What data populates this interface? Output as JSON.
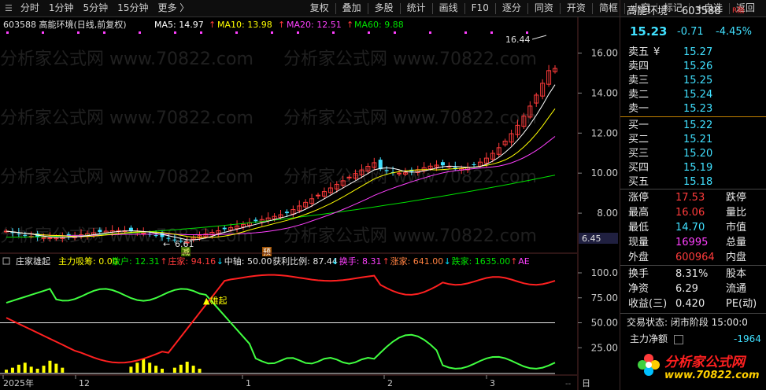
{
  "toolbar": {
    "left_items": [
      "分时",
      "1分钟",
      "5分钟",
      "15分钟",
      "更多 〉"
    ],
    "right_items": [
      "复权",
      "叠加",
      "多股",
      "统计",
      "画线",
      "F10",
      "逐分",
      "同资",
      "开资",
      "简框",
      "小窗",
      "标记",
      "+自选",
      "返回"
    ]
  },
  "info_line": {
    "stock": "603588 高能环境(日线,前复权)",
    "ma5": "MA5: 14.97",
    "ma10": "MA10: 13.98",
    "ma20": "MA20: 12.51",
    "ma60": "MA60: 9.88",
    "arrow": "↑"
  },
  "chart_labels": {
    "high_marker": "16.44",
    "low_marker": "6.61",
    "cross_price": "6.45",
    "signal_a": "减",
    "signal_b": "预",
    "signal_rise": "▲雄起"
  },
  "indicator_line": {
    "name": "庄家雄起",
    "items": [
      {
        "text": "主力吸筹: 0.00",
        "color": "#ffff00"
      },
      {
        "text": "散户: 12.31",
        "color": "#00e000",
        "arrow": "↑",
        "arrow_color": "#ff3b3b"
      },
      {
        "text": "庄家: 94.16",
        "color": "#ff3b3b",
        "arrow": "↓",
        "arrow_color": "#00e0ff"
      },
      {
        "text": "中轴: 50.00",
        "color": "#e8e8e8"
      },
      {
        "text": "获利比例: 87.44",
        "color": "#e8e8e8",
        "arrow": "↓",
        "arrow_color": "#00e0ff"
      },
      {
        "text": "换手: 8.31",
        "color": "#ff40ff",
        "arrow": "↑",
        "arrow_color": "#ff3b3b"
      },
      {
        "text": "涨家: 641.00",
        "color": "#ff8040",
        "arrow": "↓",
        "arrow_color": "#00e0ff"
      },
      {
        "text": "跌家: 1635.00",
        "color": "#00e000",
        "arrow": "↑",
        "arrow_color": "#ff3b3b"
      },
      {
        "text": "AE",
        "color": "#ff40ff"
      }
    ]
  },
  "price_axis": [
    "16.00",
    "14.00",
    "12.00",
    "10.00",
    "8.00"
  ],
  "indicator_axis": [
    "100.0",
    "75.00",
    "50.00",
    "25.00"
  ],
  "date_axis": [
    "2025年",
    "12",
    "1",
    "2",
    "3"
  ],
  "watermark": "分析家公式网 www.70822.com",
  "quote": {
    "name": "高能环境",
    "code": "603588",
    "badge": "R融",
    "price": "15.23",
    "change": "-0.71",
    "change_pct": "-4.45%",
    "asks": [
      {
        "label": "卖五",
        "unit": "¥",
        "price": "15.27"
      },
      {
        "label": "卖四",
        "price": "15.26"
      },
      {
        "label": "卖三",
        "price": "15.25"
      },
      {
        "label": "卖二",
        "price": "15.24"
      },
      {
        "label": "卖一",
        "price": "15.23"
      }
    ],
    "bids": [
      {
        "label": "买一",
        "price": "15.22"
      },
      {
        "label": "买二",
        "price": "15.21"
      },
      {
        "label": "买三",
        "price": "15.20"
      },
      {
        "label": "买四",
        "price": "15.19"
      },
      {
        "label": "买五",
        "price": "15.18"
      }
    ],
    "stats": [
      {
        "label": "涨停",
        "value": "17.53",
        "vclass": "red",
        "label2": "跌停"
      },
      {
        "label": "最高",
        "value": "16.06",
        "vclass": "red",
        "label2": "量比"
      },
      {
        "label": "最低",
        "value": "14.70",
        "vclass": "cyan",
        "label2": "市值"
      },
      {
        "label": "现量",
        "value": "16995",
        "vclass": "magenta",
        "label2": "总量"
      },
      {
        "label": "外盘",
        "value": "600964",
        "vclass": "red",
        "label2": "内盘"
      }
    ],
    "stats2": [
      {
        "label": "换手",
        "value": "8.31%",
        "label2": "股本"
      },
      {
        "label": "净资",
        "value": "6.29",
        "label2": "流通"
      },
      {
        "label": "收益(三)",
        "value": "0.420",
        "label2": "PE(动)"
      }
    ],
    "status": "交易状态: 闭市阶段 15:00:0",
    "net_label": "主力净额",
    "net_value": "-1964",
    "logo_text": "分析家公式网",
    "logo_url": "www.70822.com"
  },
  "chart_data": {
    "type": "candlestick",
    "price_range": [
      6.0,
      17.0
    ],
    "indicator_range": [
      0,
      100
    ],
    "bars": 89
  },
  "colors": {
    "up": "#ff3b3b",
    "down": "#40e0ff",
    "ma5": "#ffffff",
    "ma10": "#ffff00",
    "ma20": "#ff40ff",
    "ma60": "#00e000"
  }
}
